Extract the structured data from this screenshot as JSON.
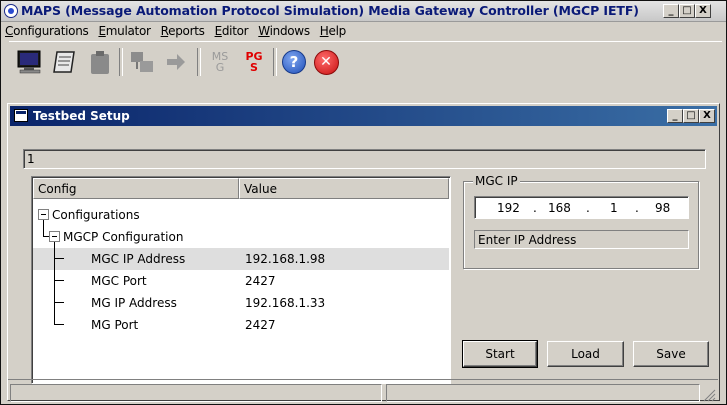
{
  "window": {
    "title": "MAPS (Message Automation Protocol Simulation) Media Gateway Controller (MGCP IETF)",
    "minimize": "_",
    "maximize": "□",
    "close": "X"
  },
  "menu": [
    {
      "label": "Configurations",
      "accel": "C",
      "rest": "onfigurations"
    },
    {
      "label": "Emulator",
      "accel": "E",
      "rest": "mulator"
    },
    {
      "label": "Reports",
      "accel": "R",
      "rest": "eports"
    },
    {
      "label": "Editor",
      "accel": "E",
      "rest": "ditor"
    },
    {
      "label": "Windows",
      "accel": "W",
      "rest": "indows"
    },
    {
      "label": "Help",
      "accel": "H",
      "rest": "elp"
    }
  ],
  "toolbar": {
    "items": [
      {
        "name": "monitor-icon"
      },
      {
        "name": "notepad-icon"
      },
      {
        "name": "clipboard-icon"
      },
      {
        "name": "network-icon"
      },
      {
        "name": "arrow-icon"
      },
      {
        "name": "ms-g-icon",
        "text_top": "MS",
        "text_bottom": "G"
      },
      {
        "name": "pg-s-icon",
        "text_top": "PG",
        "text_bottom": "S"
      },
      {
        "name": "help-icon",
        "glyph": "?"
      },
      {
        "name": "exit-icon",
        "glyph": "✕"
      }
    ]
  },
  "testbed": {
    "title": "Testbed Setup",
    "status_text": "1",
    "columns": {
      "config": "Config",
      "value": "Value"
    },
    "tree": [
      {
        "config": "Configurations",
        "value": "",
        "level": 0
      },
      {
        "config": "MGCP Configuration",
        "value": "",
        "level": 1
      },
      {
        "config": "MGC IP Address",
        "value": "192.168.1.98",
        "level": 2
      },
      {
        "config": "MGC Port",
        "value": "2427",
        "level": 2
      },
      {
        "config": "MG IP Address",
        "value": "192.168.1.33",
        "level": 2
      },
      {
        "config": "MG Port",
        "value": "2427",
        "level": 2
      }
    ],
    "mgc_ip": {
      "legend": "MGC IP",
      "octets": [
        "192",
        "168",
        "1",
        "98"
      ],
      "dot": ".",
      "hint": "Enter IP Address"
    },
    "buttons": {
      "start": "Start",
      "load": "Load",
      "save": "Save"
    }
  },
  "colors": {
    "title_text": "#0a1a78",
    "child_title_start": "#0a246a",
    "child_title_end": "#3a6ea5",
    "face": "#d4d0c8",
    "close_red": "#d81f1f",
    "help_blue": "#2f5fc8",
    "pg_red": "#e00000"
  }
}
